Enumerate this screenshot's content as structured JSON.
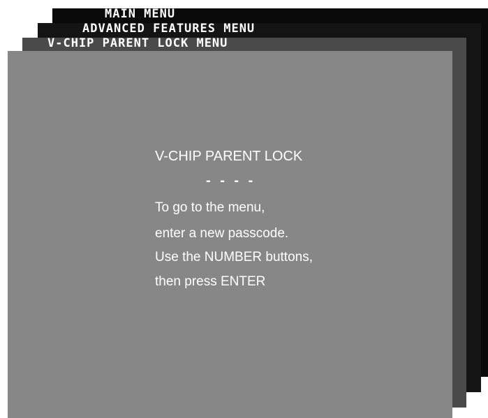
{
  "menus": {
    "main_title": "MAIN MENU",
    "advanced_title": "ADVANCED FEATURES MENU",
    "vchip_title": "V-CHIP PARENT LOCK MENU"
  },
  "panel": {
    "heading": "V-CHIP PARENT LOCK",
    "passcode_display": "- - - -",
    "instructions": [
      "To go to the menu,",
      "enter a new passcode.",
      "Use the NUMBER buttons,",
      "then press ENTER"
    ]
  },
  "colors": {
    "main_layer": "#0a0a0a",
    "advanced_layer": "#141414",
    "vchip_layer": "#4a4a4a",
    "panel": "#878787",
    "text": "#ffffff"
  }
}
